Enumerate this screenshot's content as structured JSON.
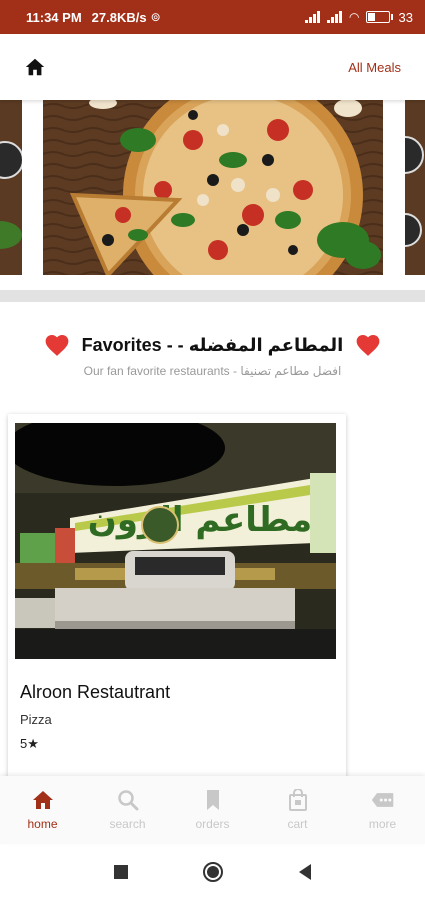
{
  "status_bar": {
    "time": "11:34 PM",
    "network_speed": "27.8KB/s",
    "battery": "33"
  },
  "app_bar": {
    "home_icon": "home-icon",
    "all_meals_label": "All Meals"
  },
  "carousel": {
    "slides": [
      "pizza",
      "pizza",
      "pizza"
    ]
  },
  "favorites": {
    "title": "Favorites -  - المطاعم المفضله",
    "subtitle": "Our fan favorite restaurants  -  افضل مطاعم تصنيفا"
  },
  "restaurants": [
    {
      "name": "Alroon Restautrant",
      "type": "Pizza",
      "rating": "5★"
    }
  ],
  "bottom_nav": {
    "items": [
      {
        "label": "home",
        "icon": "home-icon",
        "active": true
      },
      {
        "label": "search",
        "icon": "search-icon",
        "active": false
      },
      {
        "label": "orders",
        "icon": "bookmark-icon",
        "active": false
      },
      {
        "label": "cart",
        "icon": "shopping-bag-icon",
        "active": false
      },
      {
        "label": "more",
        "icon": "more-icon",
        "active": false
      }
    ]
  },
  "colors": {
    "accent": "#a23018",
    "heart": "#e53935",
    "inactive": "#c8c8c8"
  }
}
